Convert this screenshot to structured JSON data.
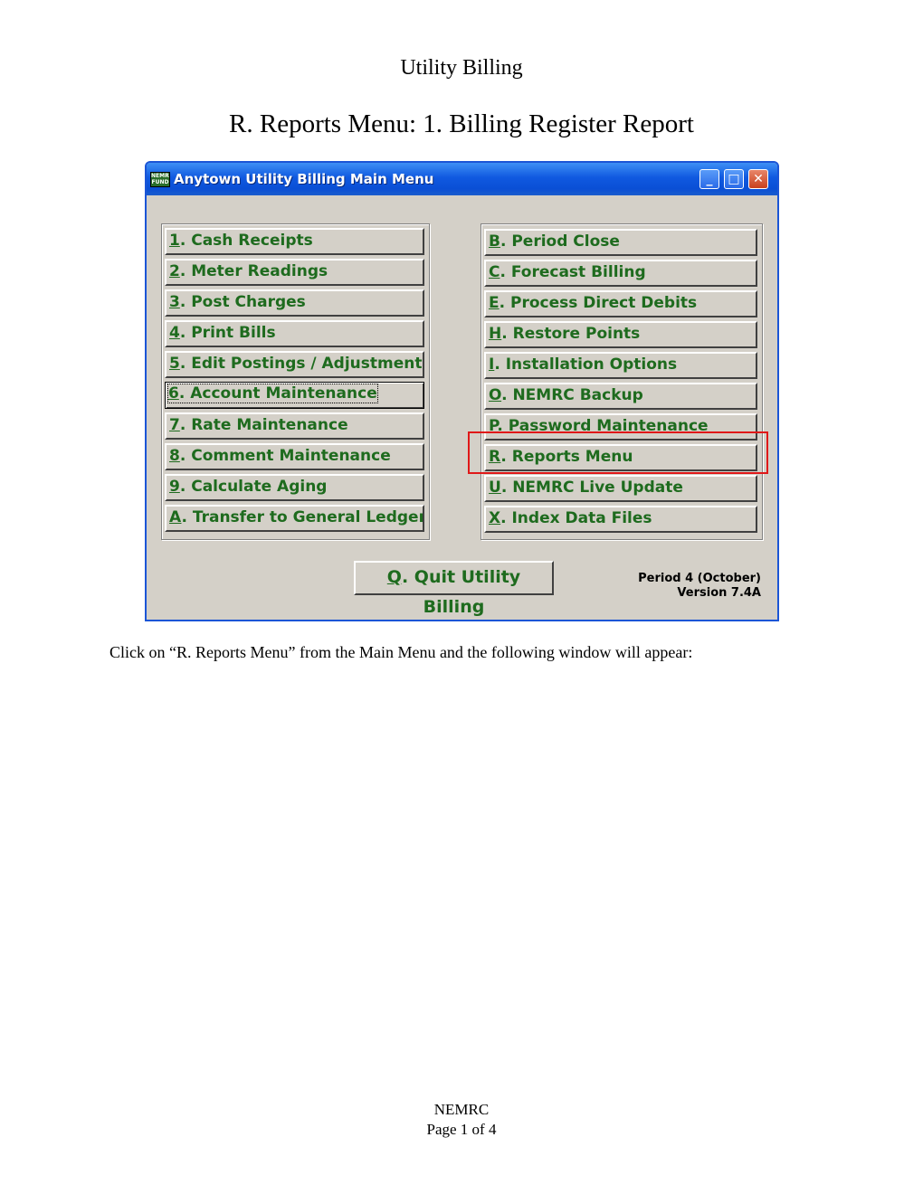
{
  "document": {
    "title": "Utility Billing",
    "subtitle": "R. Reports Menu: 1. Billing Register Report",
    "instruction": "Click on “R. Reports Menu” from the Main Menu and the following window will appear:",
    "footer_org": "NEMRC",
    "footer_page": "Page 1 of 4"
  },
  "window": {
    "title": "Anytown Utility Billing  Main Menu",
    "logo_text": "NEMRC FUND",
    "controls": {
      "minimize": "_",
      "maximize": "□",
      "close": "✕"
    }
  },
  "menu_left": [
    {
      "key": "1",
      "label": ". Cash Receipts"
    },
    {
      "key": "2",
      "label": ". Meter Readings"
    },
    {
      "key": "3",
      "label": ". Post Charges"
    },
    {
      "key": "4",
      "label": ". Print Bills"
    },
    {
      "key": "5",
      "label": ". Edit Postings / Adjustments"
    },
    {
      "key": "6",
      "label": ". Account Maintenance"
    },
    {
      "key": "7",
      "label": ". Rate Maintenance"
    },
    {
      "key": "8",
      "label": ". Comment Maintenance"
    },
    {
      "key": "9",
      "label": ". Calculate Aging"
    },
    {
      "key": "A",
      "label": ". Transfer to General Ledger"
    }
  ],
  "menu_right": [
    {
      "key": "B",
      "label": ". Period Close"
    },
    {
      "key": "C",
      "label": ". Forecast Billing"
    },
    {
      "key": "E",
      "label": ". Process Direct Debits"
    },
    {
      "key": "H",
      "label": ". Restore Points"
    },
    {
      "key": "I",
      "label": ".  Installation Options"
    },
    {
      "key": "O",
      "label": ". NEMRC Backup"
    },
    {
      "key": "P",
      "label": ". Password Maintenance"
    },
    {
      "key": "R",
      "label": ". Reports Menu"
    },
    {
      "key": "U",
      "label": ". NEMRC Live Update"
    },
    {
      "key": "X",
      "label": ". Index Data Files"
    }
  ],
  "quit": {
    "key": "Q",
    "label": ". Quit Utility Billing"
  },
  "status": {
    "period": "Period 4  (October)",
    "version": "Version 7.4A"
  },
  "highlight_color": "#e01818"
}
